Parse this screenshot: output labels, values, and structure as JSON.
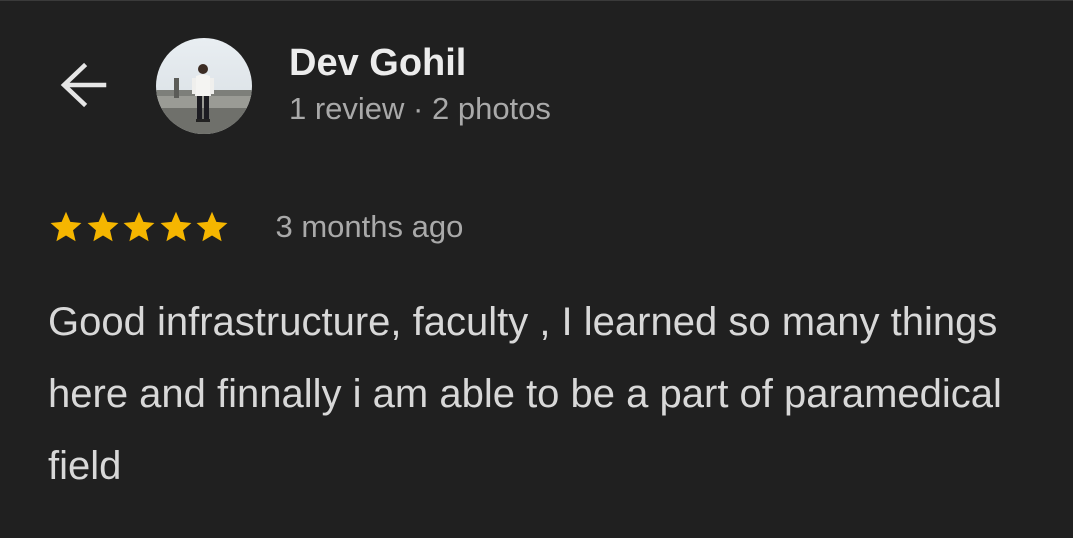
{
  "reviewer": {
    "name": "Dev Gohil",
    "meta": "1 review · 2 photos",
    "avatar_icon": "person-photo-avatar"
  },
  "navigation": {
    "back_icon": "arrow-left-icon"
  },
  "review": {
    "rating": 5,
    "rating_max": 5,
    "star_color": "#f5b600",
    "date": "3 months ago",
    "text": "Good infrastructure, faculty , I learned so many things here and finnally i am able to be a part of paramedical field"
  },
  "colors": {
    "background": "#202020",
    "name_text": "#ececec",
    "secondary_text": "#a9a9a9",
    "body_text": "#d8d8d8"
  }
}
